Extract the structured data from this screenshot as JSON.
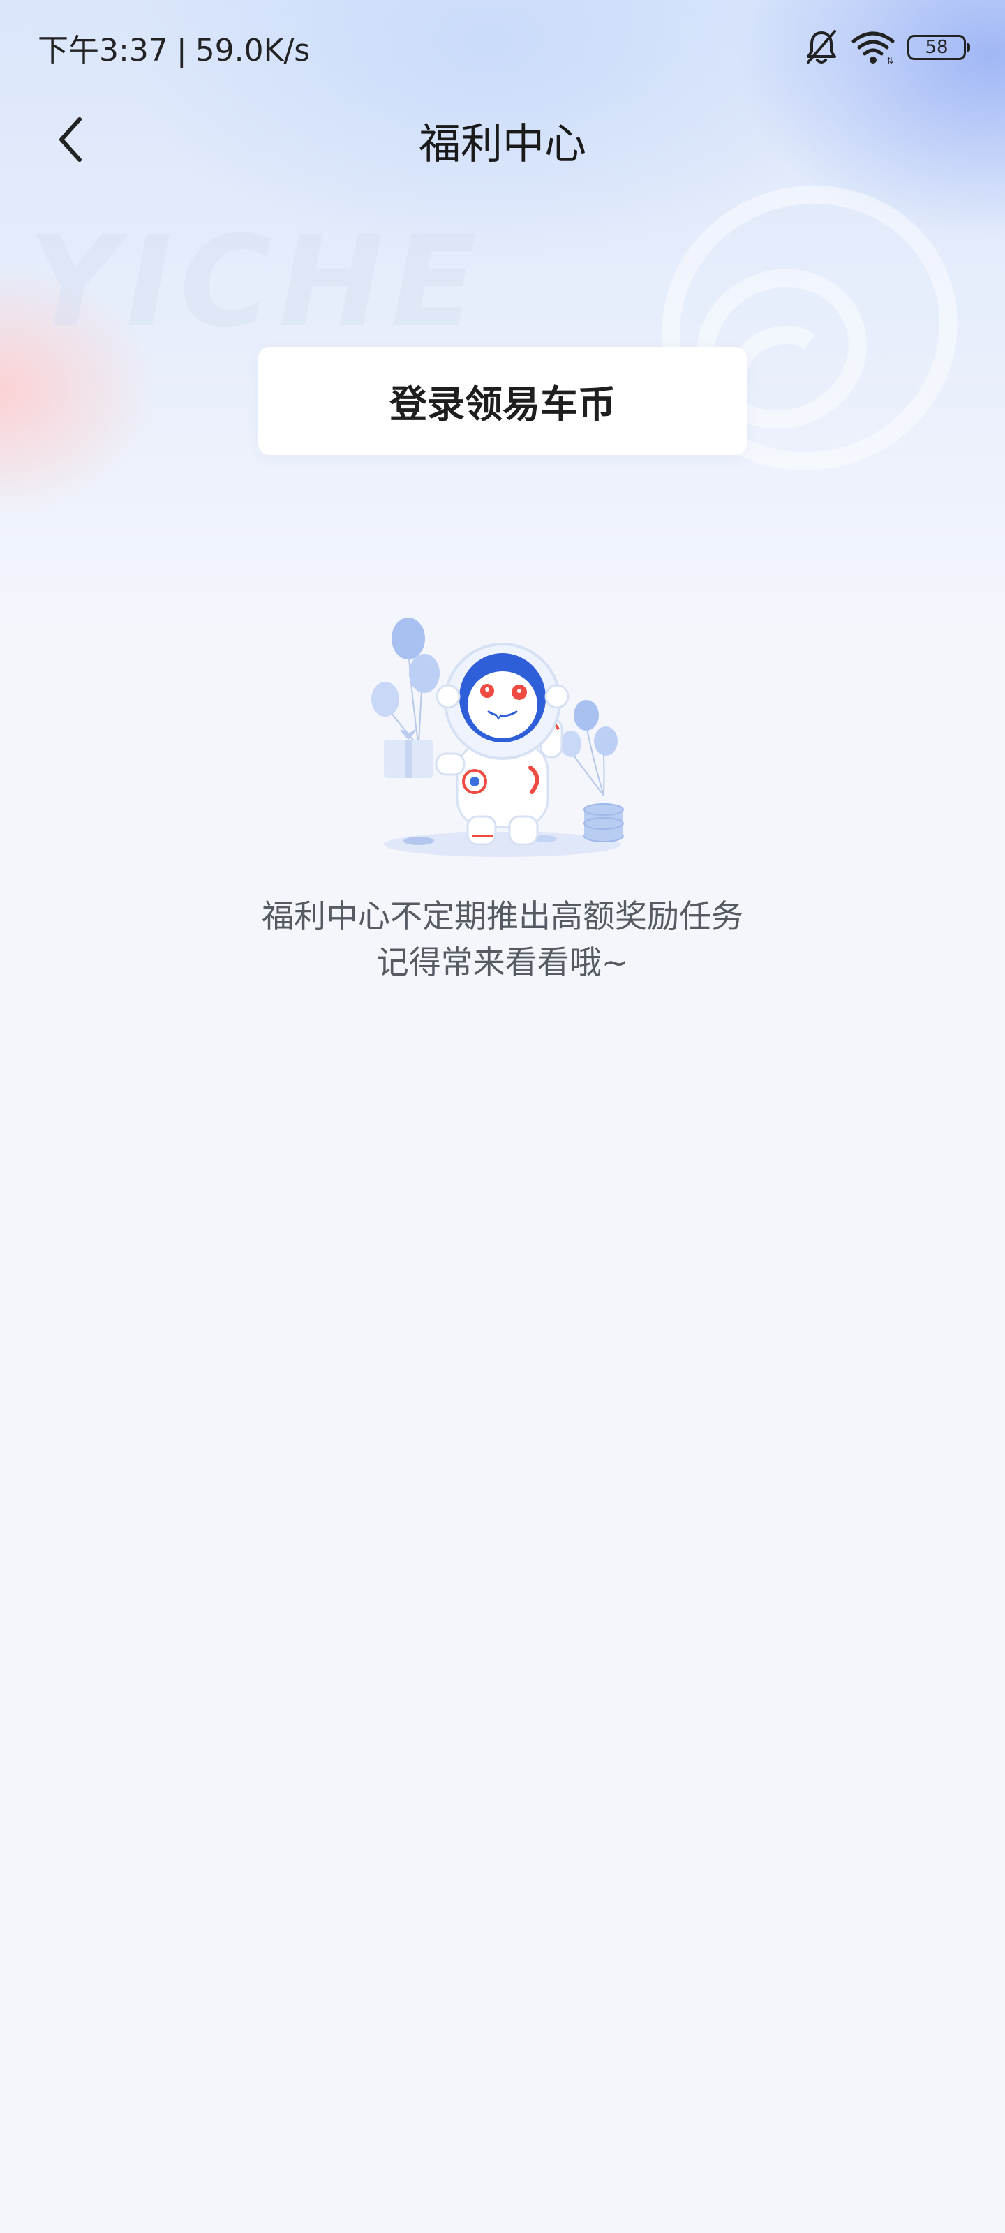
{
  "status_bar": {
    "time": "下午3:37",
    "separator": "|",
    "network_speed": "59.0K/s",
    "battery_level": "58",
    "icons": [
      "bell-muted-icon",
      "wifi-icon",
      "battery-icon"
    ]
  },
  "nav": {
    "back_icon": "chevron-left-icon",
    "title": "福利中心"
  },
  "watermark": {
    "text": "YICHE"
  },
  "login": {
    "label": "登录领易车币"
  },
  "empty_state": {
    "illustration": "astronaut-mascot-with-balloons-illustration",
    "line1": "福利中心不定期推出高额奖励任务",
    "line2": "记得常来看看哦~"
  },
  "colors": {
    "background": "#f4f6fc",
    "header_gradient_blue": "#96aff5",
    "header_gradient_pink": "#ffcdcd",
    "text_primary": "#1a1a1a",
    "text_secondary": "#555a63",
    "button_bg": "#ffffff"
  }
}
